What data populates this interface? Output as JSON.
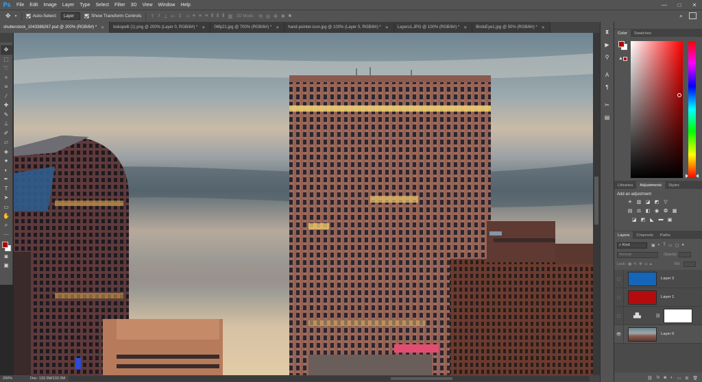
{
  "app": {
    "logo": "Ps"
  },
  "menu": [
    "File",
    "Edit",
    "Image",
    "Layer",
    "Type",
    "Select",
    "Filter",
    "3D",
    "View",
    "Window",
    "Help"
  ],
  "window_controls": {
    "minimize": "—",
    "maximize": "□",
    "close": "✕"
  },
  "options": {
    "auto_select_label": "Auto-Select:",
    "auto_select_value": "Layer",
    "show_transform_label": "Show Transform Controls",
    "mode_3d_label": "3D Mode:"
  },
  "tabs": [
    {
      "label": "shutterstock_1043386267.psd @ 200% (RGB/8#) *",
      "active": true
    },
    {
      "label": "kokopelli (1).png @ 200% (Layer 0, RGB/8#) *",
      "active": false
    },
    {
      "label": "06fp21.jpg @ 700% (RGB/8#) *",
      "active": false
    },
    {
      "label": "hand-pointer-icon.jpg @ 100% (Layer 0, RGB/8#) *",
      "active": false
    },
    {
      "label": "Layers1.JPG @ 100% (RGB/8#) *",
      "active": false
    },
    {
      "label": "BirdsEye1.jpg @ 50% (RGB/8#) *",
      "active": false
    }
  ],
  "status": {
    "zoom": "200%",
    "doc": "Doc: 132.3M/132.3M"
  },
  "color_panel": {
    "tabs": [
      "Color",
      "Swatches"
    ],
    "foreground": "#b40000",
    "background": "#ffffff"
  },
  "adjustments_panel": {
    "tabs": [
      "Libraries",
      "Adjustments",
      "Styles"
    ],
    "title": "Add an adjustment"
  },
  "layers_panel": {
    "tabs": [
      "Layers",
      "Channels",
      "Paths"
    ],
    "kind_label": "Kind",
    "blend_mode": "Normal",
    "opacity_label": "Opacity:",
    "lock_label": "Lock:",
    "fill_label": "Fill:",
    "layers": [
      {
        "name": "Layer 2",
        "color": "#1565b8",
        "visible": false
      },
      {
        "name": "Layer 1",
        "color": "#b40c0c",
        "visible": false
      },
      {
        "name": "",
        "color": "#ffffff",
        "visible": false,
        "adjustment": true
      },
      {
        "name": "Layer 0",
        "color": "photo",
        "visible": true
      }
    ]
  }
}
